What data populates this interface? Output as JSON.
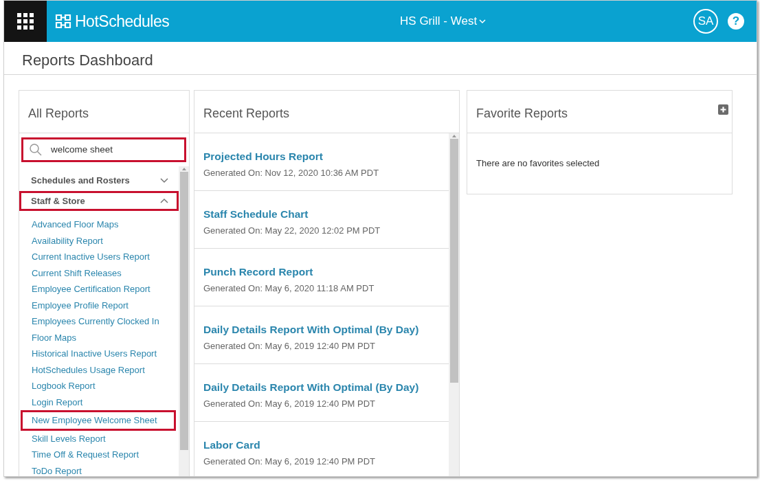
{
  "header": {
    "brand": "HotSchedules",
    "location": "HS Grill - West",
    "avatar": "SA",
    "help": "?"
  },
  "page_title": "Reports Dashboard",
  "all_reports": {
    "title": "All Reports",
    "search": {
      "value": "welcome sheet",
      "highlighted": true
    },
    "groups": [
      {
        "label": "Schedules and Rosters",
        "expanded": false,
        "highlighted": false
      },
      {
        "label": "Staff & Store",
        "expanded": true,
        "highlighted": true,
        "items": [
          {
            "label": "Advanced Floor Maps",
            "highlighted": false
          },
          {
            "label": "Availability Report",
            "highlighted": false
          },
          {
            "label": "Current Inactive Users Report",
            "highlighted": false
          },
          {
            "label": "Current Shift Releases",
            "highlighted": false
          },
          {
            "label": "Employee Certification Report",
            "highlighted": false
          },
          {
            "label": "Employee Profile Report",
            "highlighted": false
          },
          {
            "label": "Employees Currently Clocked In",
            "highlighted": false
          },
          {
            "label": "Floor Maps",
            "highlighted": false
          },
          {
            "label": "Historical Inactive Users Report",
            "highlighted": false
          },
          {
            "label": "HotSchedules Usage Report",
            "highlighted": false
          },
          {
            "label": "Logbook Report",
            "highlighted": false
          },
          {
            "label": "Login Report",
            "highlighted": false
          },
          {
            "label": "New Employee Welcome Sheet",
            "highlighted": true
          },
          {
            "label": "Skill Levels Report",
            "highlighted": false
          },
          {
            "label": "Time Off & Request Report",
            "highlighted": false
          },
          {
            "label": "ToDo Report",
            "highlighted": false
          }
        ]
      }
    ]
  },
  "recent_reports": {
    "title": "Recent Reports",
    "items": [
      {
        "name": "Projected Hours Report",
        "generated": "Generated On: Nov 12, 2020 10:36 AM PDT"
      },
      {
        "name": "Staff Schedule Chart",
        "generated": "Generated On: May 22, 2020 12:02 PM PDT"
      },
      {
        "name": "Punch Record Report",
        "generated": "Generated On: May 6, 2020 11:18 AM PDT"
      },
      {
        "name": "Daily Details Report With Optimal (By Day)",
        "generated": "Generated On: May 6, 2019 12:40 PM PDT"
      },
      {
        "name": "Daily Details Report With Optimal (By Day)",
        "generated": "Generated On: May 6, 2019 12:40 PM PDT"
      },
      {
        "name": "Labor Card",
        "generated": "Generated On: May 6, 2019 12:40 PM PDT"
      }
    ]
  },
  "favorite_reports": {
    "title": "Favorite Reports",
    "empty_message": "There are no favorites selected"
  }
}
